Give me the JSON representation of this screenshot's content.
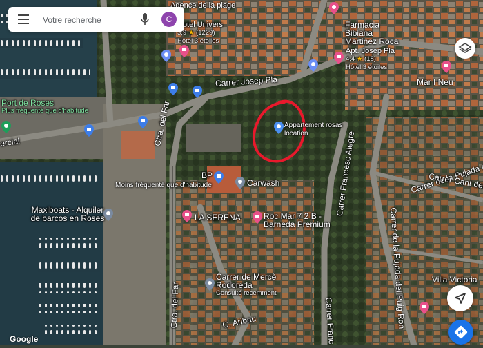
{
  "search": {
    "placeholder": "Votre recherche",
    "avatar_letter": "C"
  },
  "logo": "Google",
  "places": {
    "agence": "Agence de la plage",
    "hotel_univers": {
      "name": "Hotel Univers",
      "rating": "3,9",
      "reviews": "(1229)",
      "category": "Hôtel 3 étoiles"
    },
    "farmacia": "Farmacia Bibiana Martinez Roca",
    "apt_josep": {
      "name": "Apt. Josep Pla",
      "rating": "4,4",
      "reviews": "(18)",
      "category": "Hôtel 3 étoiles"
    },
    "mar_i_neu": "Mar I Neu",
    "port_roses": {
      "name": "Port de Roses",
      "note": "Plus fréquenté que d'habitude"
    },
    "apartment": "Appartement rosas location",
    "bp": {
      "name": "BP",
      "note": "Moins fréquenté que d'habitude"
    },
    "carwash": "Carwash",
    "maxiboats": "Maxiboats - Alquiler de barcos en Roses",
    "la_serena": "LA SERENA",
    "roc_mar": "Roc Mar 7 2 B - Barneda Premium",
    "rodoreda": {
      "name": "Carrer de Mercè Rodoreda",
      "note": "Consulté récemment"
    },
    "villa_victoria": "Villa Victoria"
  },
  "streets": {
    "josep_pla": "Carrer Josep Pla",
    "del_far_top": "Ctra. del Far",
    "del_far_bottom": "Ctra. del Far",
    "comercial": "ercial",
    "francesc_alegre": "Carrer Francesc Alegre",
    "pujada_puig_1": "Carrer de la Pujada del Puig",
    "cant_del": "Carrer Cant del",
    "pujada_puig_ron": "Carrer de la Pujada del Puig Ron",
    "aribau": "C. Aribau",
    "franc": "Carrer Franc"
  }
}
